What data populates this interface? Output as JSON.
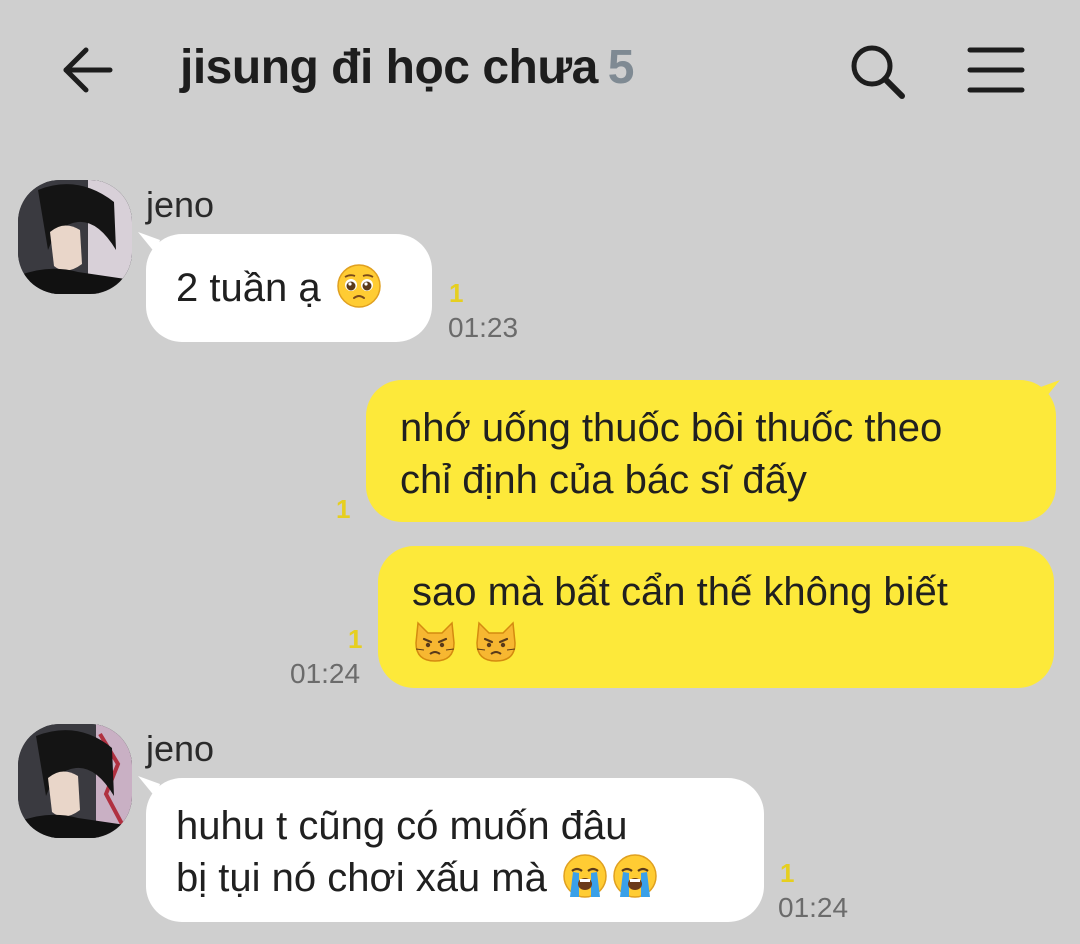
{
  "header": {
    "title": "jisung đi học chưa",
    "member_count": "5"
  },
  "messages": [
    {
      "sender": "jeno",
      "lines": [
        "2 tuần ạ"
      ],
      "emojis": [
        "pleading-face"
      ],
      "unread": "1",
      "time": "01:23"
    },
    {
      "sender": "me",
      "lines": [
        "nhớ uống thuốc bôi thuốc theo",
        "chỉ định của bác sĩ đấy"
      ],
      "unread": "1"
    },
    {
      "sender": "me",
      "lines": [
        "sao mà bất cẩn thế không biết"
      ],
      "emojis": [
        "pouting-cat",
        "pouting-cat"
      ],
      "unread": "1",
      "time": "01:24"
    },
    {
      "sender": "jeno",
      "lines": [
        "huhu t cũng có muốn đâu",
        "bị tụi nó chơi xấu mà"
      ],
      "emojis": [
        "loudly-crying-face",
        "loudly-crying-face"
      ],
      "unread": "1",
      "time": "01:24"
    }
  ],
  "colors": {
    "background": "#cfcfcf",
    "outgoing_bubble": "#fde93a",
    "incoming_bubble": "#ffffff",
    "unread_count": "#e6cf1f",
    "member_count": "#7f8a93"
  }
}
